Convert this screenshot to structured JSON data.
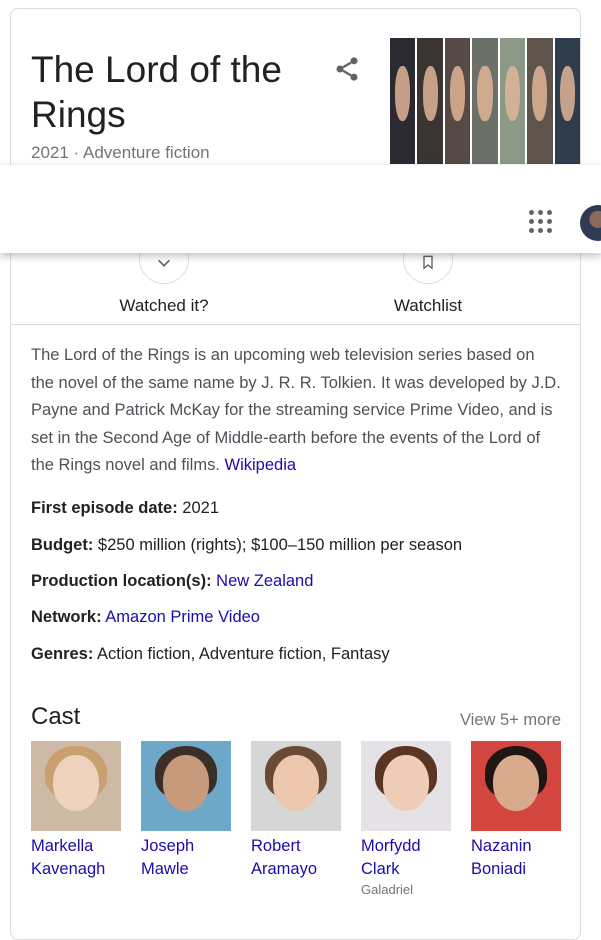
{
  "header": {
    "title": "The Lord of the Rings",
    "subtitle": "2021 · Adventure fiction"
  },
  "actions": {
    "watched_label": "Watched it?",
    "watchlist_label": "Watchlist"
  },
  "description": {
    "text": "The Lord of the Rings is an upcoming web television series based on the novel of the same name by J. R. R. Tolkien. It was developed by J.D. Payne and Patrick McKay for the streaming service Prime Video, and is set in the Second Age of Middle-earth before the events of the Lord of the Rings novel and films.",
    "source_link": "Wikipedia"
  },
  "facts": {
    "first_episode_label": "First episode date:",
    "first_episode_value": "2021",
    "budget_label": "Budget:",
    "budget_value": "$250 million (rights); $100–150 million per season",
    "location_label": "Production location(s):",
    "location_value": "New Zealand",
    "network_label": "Network:",
    "network_value": "Amazon Prime Video",
    "genres_label": "Genres:",
    "genres_value": "Action fiction, Adventure fiction, Fantasy"
  },
  "cast": {
    "heading": "Cast",
    "more_link": "View 5+ more",
    "members": [
      {
        "name1": "Markella",
        "name2": "Kavenagh",
        "role": ""
      },
      {
        "name1": "Joseph",
        "name2": "Mawle",
        "role": ""
      },
      {
        "name1": "Robert",
        "name2": "Aramayo",
        "role": ""
      },
      {
        "name1": "Morfydd",
        "name2": "Clark",
        "role": "Galadriel"
      },
      {
        "name1": "Nazanin",
        "name2": "Boniadi",
        "role": ""
      }
    ]
  }
}
